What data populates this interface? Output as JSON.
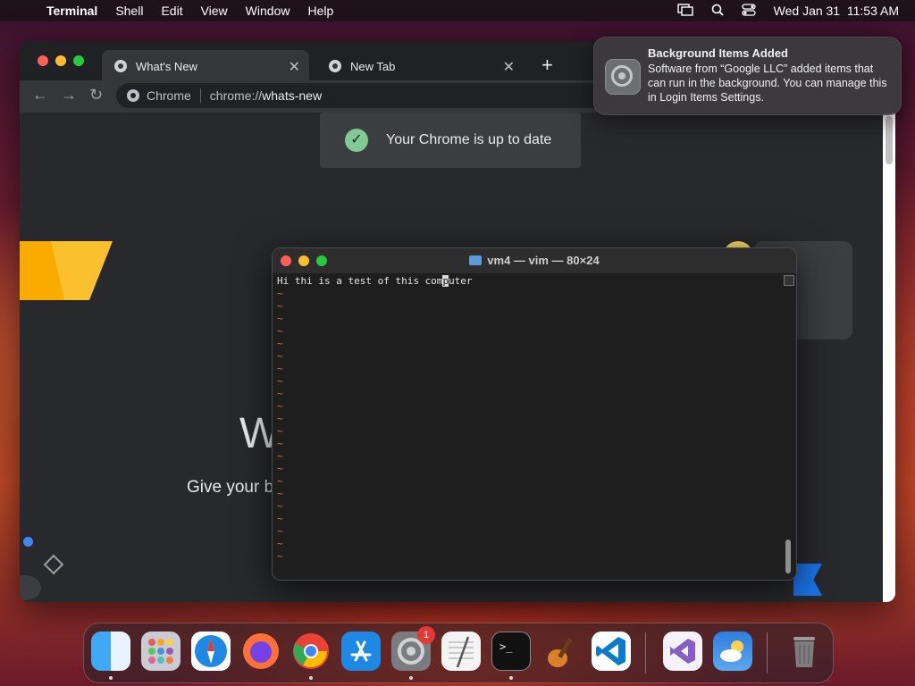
{
  "menubar": {
    "apple": "",
    "app_name": "Terminal",
    "items": [
      "Shell",
      "Edit",
      "View",
      "Window",
      "Help"
    ],
    "datetime": "Wed Jan 31  11:53 AM"
  },
  "chrome": {
    "tabs": [
      {
        "label": "What's New"
      },
      {
        "label": "New Tab"
      }
    ],
    "omnibox": {
      "site": "Chrome",
      "url_prefix": "chrome://",
      "url_bold": "whats-new"
    },
    "toast": "Your Chrome is up to date",
    "page": {
      "heading_partial": "W",
      "subtitle_partial": "Give your b"
    }
  },
  "terminal": {
    "title": "vm4 — vim — 80×24",
    "line1_before": "Hi thi is a test of this com",
    "cursor_char": "p",
    "line1_after": "uter",
    "tilde_count": 22
  },
  "notification": {
    "title": "Background Items Added",
    "body": "Software from “Google LLC” added items that can run in the background. You can manage this in Login Items Settings."
  },
  "dock": {
    "apps": [
      "Finder",
      "Launchpad",
      "Safari",
      "Firefox",
      "Google Chrome",
      "App Store",
      "System Settings",
      "TextEdit",
      "Terminal",
      "GarageBand",
      "Visual Studio Code",
      "Visual Studio",
      "Weather",
      "Trash"
    ],
    "settings_badge": "1"
  },
  "colors": {
    "chrome_bg": "#202124",
    "terminal_bg": "#1e1e1e",
    "tilde": "#e06c6c",
    "toast_check": "#81c995"
  }
}
